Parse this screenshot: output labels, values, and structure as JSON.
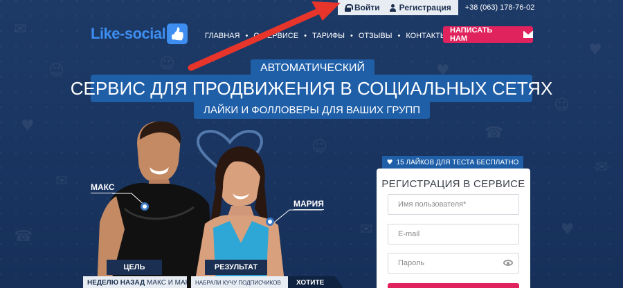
{
  "topbar": {
    "login_label": "Войти",
    "register_label": "Регистрация",
    "phone": "+38 (063) 178-76-02"
  },
  "logo": {
    "text": "Like-social"
  },
  "nav": {
    "items": [
      {
        "label": "ГЛАВНАЯ"
      },
      {
        "label": "О СЕРВИСЕ"
      },
      {
        "label": "ТАРИФЫ"
      },
      {
        "label": "ОТЗЫВЫ"
      },
      {
        "label": "КОНТАКТЫ"
      }
    ]
  },
  "write_button": {
    "label": "НАПИСАТЬ НАМ"
  },
  "hero": {
    "line1": "АВТОМАТИЧЕСКИЙ",
    "line2": "СЕРВИС ДЛЯ ПРОДВИЖЕНИЯ В СОЦИАЛЬНЫХ СЕТЯХ",
    "line3": "ЛАЙКИ И ФОЛЛОВЕРЫ ДЛЯ ВАШИХ ГРУПП"
  },
  "people": {
    "max_label": "МАКС",
    "maria_label": "МАРИЯ",
    "goal_tab": "ЦЕЛЬ",
    "result_tab": "РЕЗУЛЬТАТ",
    "goal_strong": "НЕДЕЛЮ НАЗАД",
    "goal_text": "МАКС И МАРИЯ",
    "result_text": "НАБРАЛИ КУЧУ ПОДПИСЧИКОВ",
    "want_text": "ХОТИТЕ"
  },
  "registration": {
    "promo": "15 ЛАЙКОВ ДЛЯ ТЕСТА БЕСПЛАТНО",
    "title": "РЕГИСТРАЦИЯ В СЕРВИСЕ",
    "username_placeholder": "Имя пользователя*",
    "email_placeholder": "E-mail",
    "password_placeholder": "Пароль"
  },
  "colors": {
    "background": "#1a3561",
    "accent_blue": "#1f5fa8",
    "logo_blue": "#3d8ef0",
    "cta_pink": "#e0235d",
    "arrow_red": "#e8352b"
  }
}
